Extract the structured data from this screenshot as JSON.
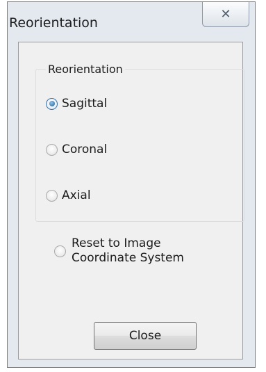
{
  "dialog": {
    "title": "Reorientation",
    "close_glyph": "✕"
  },
  "group": {
    "legend": "Reorientation",
    "options": [
      {
        "label": "Sagittal",
        "checked": true
      },
      {
        "label": "Coronal",
        "checked": false
      },
      {
        "label": "Axial",
        "checked": false
      }
    ]
  },
  "reset": {
    "label_line1": "Reset to Image",
    "label_line2": "Coordinate System",
    "checked": false
  },
  "buttons": {
    "close_label": "Close"
  }
}
